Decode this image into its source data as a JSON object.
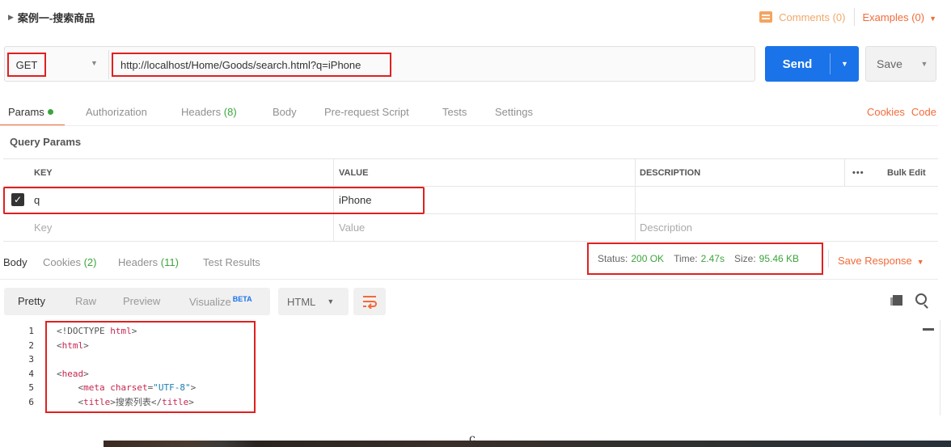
{
  "header": {
    "title": "案例一-搜索商品",
    "comments": "Comments (0)",
    "examples": "Examples (0)"
  },
  "request": {
    "method": "GET",
    "url": "http://localhost/Home/Goods/search.html?q=iPhone",
    "send_label": "Send",
    "save_label": "Save"
  },
  "tabs": {
    "params": "Params",
    "authorization": "Authorization",
    "headers_label": "Headers",
    "headers_count": "(8)",
    "body": "Body",
    "prerequest": "Pre-request Script",
    "tests": "Tests",
    "settings": "Settings",
    "cookies": "Cookies",
    "code": "Code"
  },
  "query_params": {
    "title": "Query Params",
    "columns": {
      "key": "KEY",
      "value": "VALUE",
      "description": "DESCRIPTION"
    },
    "bulk_edit": "Bulk Edit",
    "more": "•••",
    "rows": [
      {
        "checked": true,
        "key": "q",
        "value": "iPhone",
        "description": ""
      }
    ],
    "placeholder": {
      "key": "Key",
      "value": "Value",
      "description": "Description"
    }
  },
  "response": {
    "tabs": {
      "body": "Body",
      "cookies_label": "Cookies",
      "cookies_count": "(2)",
      "headers_label": "Headers",
      "headers_count": "(11)",
      "test_results": "Test Results"
    },
    "status_label": "Status:",
    "status_value": "200 OK",
    "time_label": "Time:",
    "time_value": "2.47s",
    "size_label": "Size:",
    "size_value": "95.46 KB",
    "save_response": "Save Response",
    "view": {
      "pretty": "Pretty",
      "raw": "Raw",
      "preview": "Preview",
      "visualize": "Visualize",
      "beta": "BETA",
      "format": "HTML"
    },
    "code_lines": [
      {
        "n": "1",
        "parts": [
          [
            "p",
            "<!DOCTYPE "
          ],
          [
            "t",
            "html"
          ],
          [
            "p",
            ">"
          ]
        ]
      },
      {
        "n": "2",
        "parts": [
          [
            "p",
            "<"
          ],
          [
            "t",
            "html"
          ],
          [
            "p",
            ">"
          ]
        ]
      },
      {
        "n": "3",
        "parts": []
      },
      {
        "n": "4",
        "parts": [
          [
            "p",
            "<"
          ],
          [
            "t",
            "head"
          ],
          [
            "p",
            ">"
          ]
        ]
      },
      {
        "n": "5",
        "parts": [
          [
            "p",
            "    <"
          ],
          [
            "t",
            "meta "
          ],
          [
            "a",
            "charset"
          ],
          [
            "p",
            "="
          ],
          [
            "s",
            "\"UTF-8\""
          ],
          [
            "p",
            ">"
          ]
        ]
      },
      {
        "n": "6",
        "parts": [
          [
            "p",
            "    <"
          ],
          [
            "t",
            "title"
          ],
          [
            "p",
            ">搜索列表</"
          ],
          [
            "t",
            "title"
          ],
          [
            "p",
            ">"
          ]
        ]
      }
    ]
  },
  "footer_glyph": "c",
  "colors": {
    "accent": "#f26b3a",
    "send_blue": "#1a73e8",
    "success_green": "#3ca43c",
    "annotation_red": "#e02020"
  }
}
